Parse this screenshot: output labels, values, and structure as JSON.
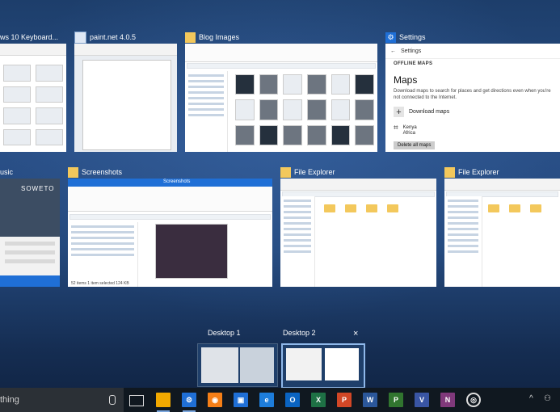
{
  "windows": {
    "keyboard": {
      "title": "ws 10 Keyboard..."
    },
    "paint": {
      "title": "paint.net 4.0.5"
    },
    "blog": {
      "title": "Blog Images"
    },
    "settings": {
      "title": "Settings",
      "app_header": "Settings",
      "section": "OFFLINE MAPS",
      "heading": "Maps",
      "description": "Download maps to search for places and get directions even when you're not connected to the Internet.",
      "download_label": "Download maps",
      "region_name": "Kenya",
      "region_sub": "Africa",
      "delete_button": "Delete all maps"
    },
    "music": {
      "title": "usic",
      "album_text": "SOWETO"
    },
    "screenshots": {
      "title": "Screenshots",
      "window_label": "Screenshots",
      "status": "52 items   1 item selected  124 KB"
    },
    "explorer1": {
      "title": "File Explorer"
    },
    "explorer2": {
      "title": "File Explorer"
    }
  },
  "desktops": [
    {
      "label": "Desktop 1"
    },
    {
      "label": "Desktop 2",
      "close": "×"
    }
  ],
  "taskbar": {
    "search_placeholder": "thing",
    "apps": [
      {
        "name": "file-explorer-icon",
        "glyph": "",
        "color": "#f2a900"
      },
      {
        "name": "settings-icon",
        "glyph": "⚙",
        "color": "#1f6fd6"
      },
      {
        "name": "firefox-icon",
        "glyph": "◉",
        "color": "#f57f17"
      },
      {
        "name": "photos-icon",
        "glyph": "▣",
        "color": "#1f6fd6"
      },
      {
        "name": "edge-icon",
        "glyph": "e",
        "color": "#1d7ddb"
      },
      {
        "name": "outlook-icon",
        "glyph": "O",
        "color": "#0a64c2"
      },
      {
        "name": "excel-icon",
        "glyph": "X",
        "color": "#1e7145"
      },
      {
        "name": "powerpoint-icon",
        "glyph": "P",
        "color": "#d24726"
      },
      {
        "name": "word-icon",
        "glyph": "W",
        "color": "#2b579a"
      },
      {
        "name": "project-icon",
        "glyph": "P",
        "color": "#31752f"
      },
      {
        "name": "visio-icon",
        "glyph": "V",
        "color": "#3955a3"
      },
      {
        "name": "onenote-icon",
        "glyph": "N",
        "color": "#80397b"
      },
      {
        "name": "groove-icon",
        "glyph": "◎",
        "color": "#101820"
      }
    ],
    "tray_caret": "^",
    "tray_people": "⚇"
  }
}
